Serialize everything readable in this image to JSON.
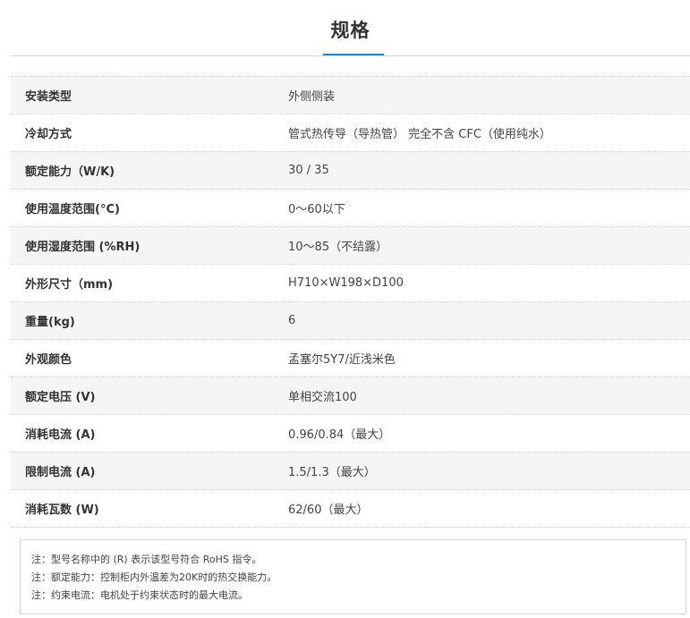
{
  "section": {
    "title": "规格"
  },
  "specs": [
    {
      "label": "安装类型",
      "value": "外侧侧装"
    },
    {
      "label": "冷却方式",
      "value": "管式热传导（导热管） 完全不含 CFC（使用纯水）"
    },
    {
      "label": "额定能力（W/K)",
      "value": "30 / 35"
    },
    {
      "label": "使用温度范围(°C)",
      "value": "0～60以下"
    },
    {
      "label": "使用湿度范围 (%RH)",
      "value": "10～85（不结露）"
    },
    {
      "label": "外形尺寸（mm)",
      "value": "H710×W198×D100"
    },
    {
      "label": "重量(kg)",
      "value": "6"
    },
    {
      "label": "外观颜色",
      "value": "孟塞尔5Y7/近浅米色"
    },
    {
      "label": "额定电压 (V)",
      "value": "单相交流100"
    },
    {
      "label": "消耗电流 (A)",
      "value": "0.96/0.84（最大）"
    },
    {
      "label": "限制电流 (A)",
      "value": "1.5/1.3（最大）"
    },
    {
      "label": "消耗瓦数 (W)",
      "value": "62/60（最大）"
    }
  ],
  "notes": [
    "注：型号名称中的 (R) 表示该型号符合 RoHS 指令。",
    "注：额定能力：控制柜内外温差为20K时的热交换能力。",
    "注：约束电流：电机处于约束状态时的最大电流。"
  ],
  "colors": {
    "accent": "#1a8ad4",
    "row_stripe": "#f5f5f5",
    "text": "#333333"
  }
}
